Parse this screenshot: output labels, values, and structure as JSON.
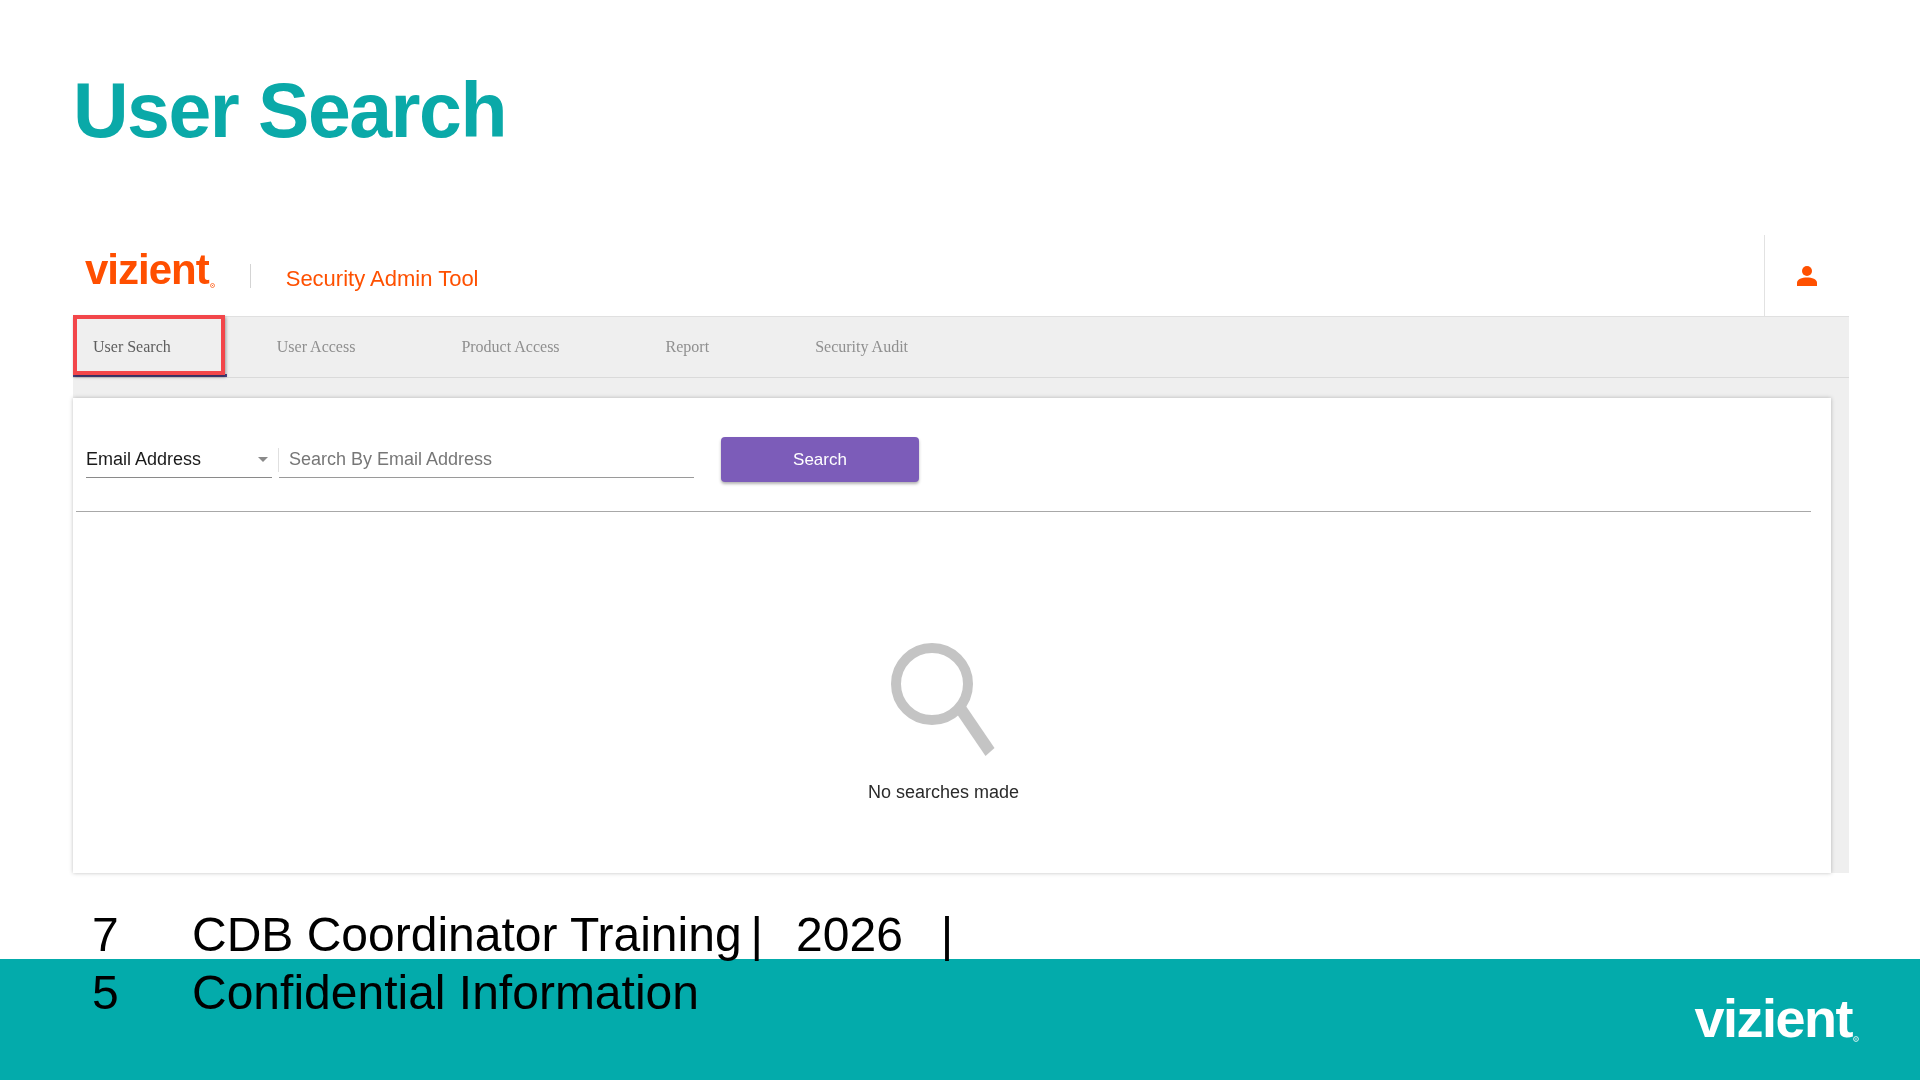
{
  "slide": {
    "title": "User Search"
  },
  "app": {
    "header": {
      "logo": "vizient",
      "app_name": "Security Admin Tool"
    },
    "tabs": [
      {
        "label": "User Search",
        "selected": true,
        "highlighted": true
      },
      {
        "label": "User Access",
        "selected": false,
        "highlighted": false
      },
      {
        "label": "Product Access",
        "selected": false,
        "highlighted": false
      },
      {
        "label": "Report",
        "selected": false,
        "highlighted": false
      },
      {
        "label": "Security Audit",
        "selected": false,
        "highlighted": false
      }
    ],
    "search": {
      "field_type": "Email Address",
      "placeholder": "Search By Email Address",
      "button": "Search"
    },
    "empty_state": {
      "message": "No searches made"
    }
  },
  "footer": {
    "page_number_lines": [
      "7",
      "5"
    ],
    "course": "CDB Coordinator Training",
    "separators": [
      "|",
      "|"
    ],
    "year": "2026",
    "notice": "Confidential Information",
    "logo": "vizient"
  }
}
